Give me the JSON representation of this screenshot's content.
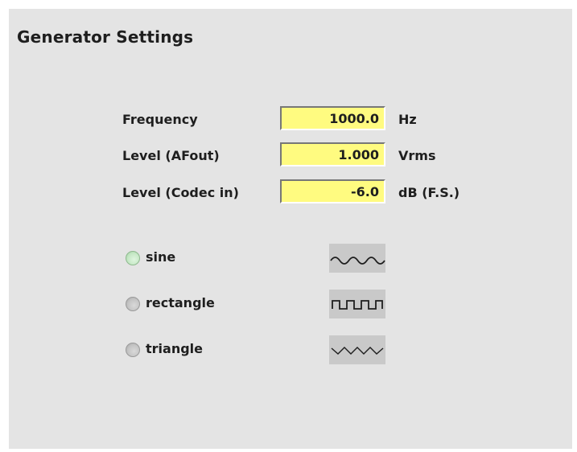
{
  "panel": {
    "title": "Generator Settings"
  },
  "fields": [
    {
      "label": "Frequency",
      "value": "1000.0",
      "unit": "Hz"
    },
    {
      "label": "Level (AFout)",
      "value": "1.000",
      "unit": "Vrms"
    },
    {
      "label": "Level (Codec in)",
      "value": "-6.0",
      "unit": "dB (F.S.)"
    }
  ],
  "waveforms": {
    "selected": "sine",
    "options": [
      {
        "label": "sine",
        "icon": "sine-wave-icon"
      },
      {
        "label": "rectangle",
        "icon": "square-wave-icon"
      },
      {
        "label": "triangle",
        "icon": "triangle-wave-icon"
      }
    ]
  },
  "colors": {
    "panel_bg": "#e4e4e4",
    "field_bg": "#fffb80",
    "radio_selected": "#c6e8c6",
    "radio_unselected": "#c4c4c4",
    "icon_bg": "#c9c9c9"
  }
}
